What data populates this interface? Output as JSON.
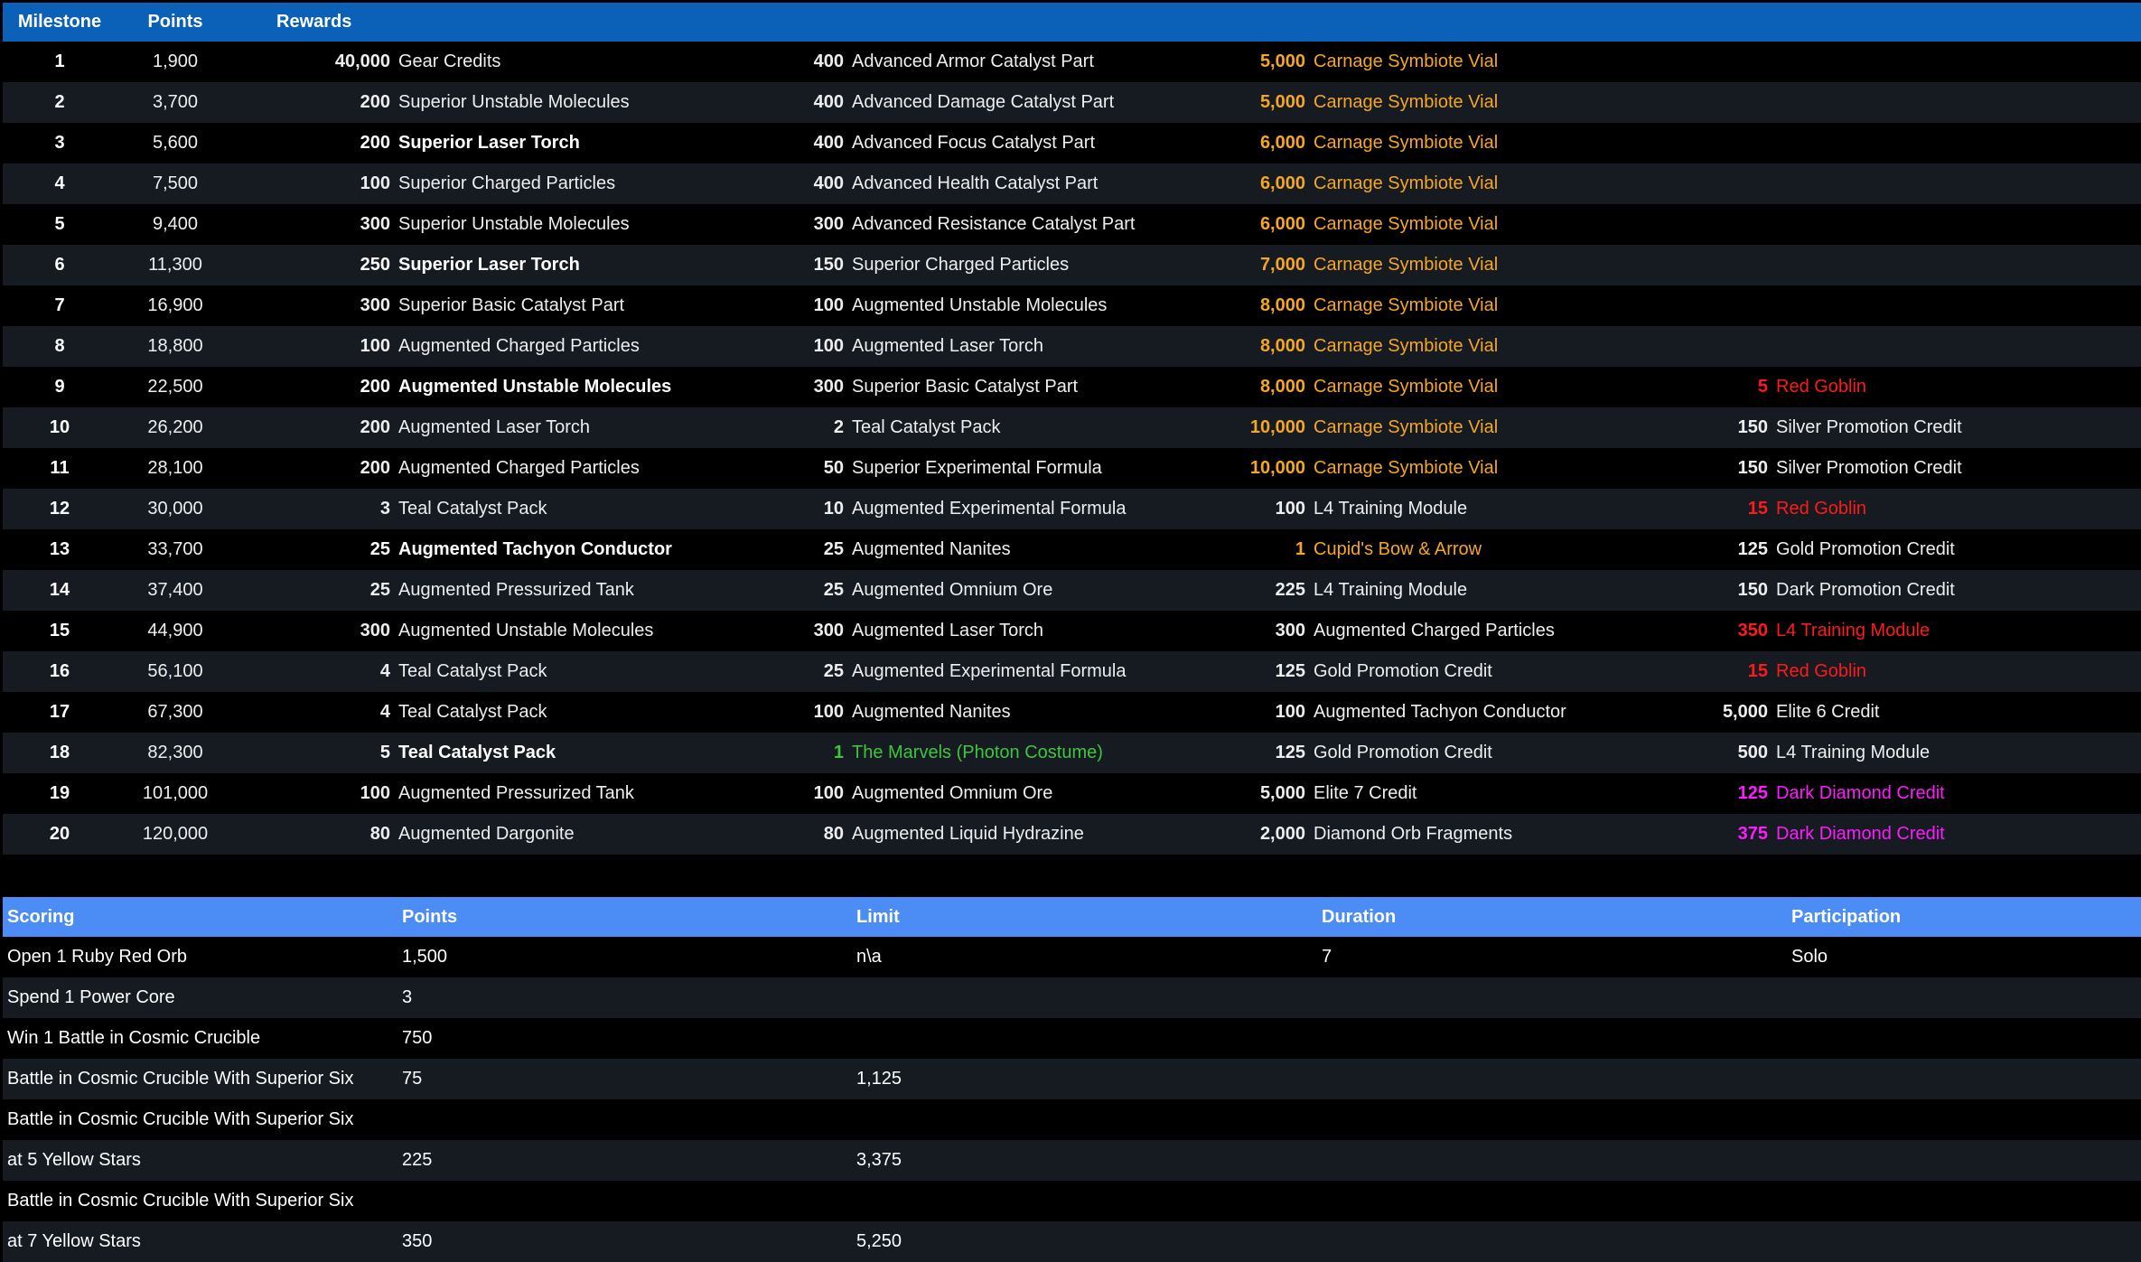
{
  "milestones_table": {
    "headers": {
      "milestone": "Milestone",
      "points": "Points",
      "rewards": "Rewards"
    },
    "colors": {
      "header_bg": "#0b61b8",
      "orange": "#f5a623",
      "red": "#ff1a1a",
      "green": "#3ec53e",
      "magenta": "#ff1aff"
    },
    "rows": [
      {
        "milestone": "1",
        "points": "1,900",
        "r1": {
          "q": "40,000",
          "n": "Gear Credits",
          "c": "white"
        },
        "r2": {
          "q": "400",
          "n": "Advanced Armor Catalyst Part",
          "c": "white"
        },
        "r3": {
          "q": "5,000",
          "n": "Carnage Symbiote Vial",
          "c": "orange"
        },
        "r4": {
          "q": "",
          "n": "",
          "c": "white"
        }
      },
      {
        "milestone": "2",
        "points": "3,700",
        "r1": {
          "q": "200",
          "n": "Superior Unstable Molecules",
          "c": "white"
        },
        "r2": {
          "q": "400",
          "n": "Advanced Damage Catalyst Part",
          "c": "white"
        },
        "r3": {
          "q": "5,000",
          "n": "Carnage Symbiote Vial",
          "c": "orange"
        },
        "r4": {
          "q": "",
          "n": "",
          "c": "white"
        }
      },
      {
        "milestone": "3",
        "points": "5,600",
        "r1": {
          "q": "200",
          "n": "Superior Laser Torch",
          "c": "bold"
        },
        "r2": {
          "q": "400",
          "n": "Advanced Focus Catalyst Part",
          "c": "white"
        },
        "r3": {
          "q": "6,000",
          "n": "Carnage Symbiote Vial",
          "c": "orange"
        },
        "r4": {
          "q": "",
          "n": "",
          "c": "white"
        }
      },
      {
        "milestone": "4",
        "points": "7,500",
        "r1": {
          "q": "100",
          "n": "Superior Charged Particles",
          "c": "white"
        },
        "r2": {
          "q": "400",
          "n": "Advanced Health Catalyst Part",
          "c": "white"
        },
        "r3": {
          "q": "6,000",
          "n": "Carnage Symbiote Vial",
          "c": "orange"
        },
        "r4": {
          "q": "",
          "n": "",
          "c": "white"
        }
      },
      {
        "milestone": "5",
        "points": "9,400",
        "r1": {
          "q": "300",
          "n": "Superior Unstable Molecules",
          "c": "white"
        },
        "r2": {
          "q": "300",
          "n": "Advanced Resistance Catalyst Part",
          "c": "white"
        },
        "r3": {
          "q": "6,000",
          "n": "Carnage Symbiote Vial",
          "c": "orange"
        },
        "r4": {
          "q": "",
          "n": "",
          "c": "white"
        }
      },
      {
        "milestone": "6",
        "points": "11,300",
        "r1": {
          "q": "250",
          "n": "Superior Laser Torch",
          "c": "bold"
        },
        "r2": {
          "q": "150",
          "n": "Superior Charged Particles",
          "c": "white"
        },
        "r3": {
          "q": "7,000",
          "n": "Carnage Symbiote Vial",
          "c": "orange"
        },
        "r4": {
          "q": "",
          "n": "",
          "c": "white"
        }
      },
      {
        "milestone": "7",
        "points": "16,900",
        "r1": {
          "q": "300",
          "n": "Superior Basic Catalyst Part",
          "c": "white"
        },
        "r2": {
          "q": "100",
          "n": "Augmented Unstable Molecules",
          "c": "white"
        },
        "r3": {
          "q": "8,000",
          "n": "Carnage Symbiote Vial",
          "c": "orange"
        },
        "r4": {
          "q": "",
          "n": "",
          "c": "white"
        }
      },
      {
        "milestone": "8",
        "points": "18,800",
        "r1": {
          "q": "100",
          "n": "Augmented Charged Particles",
          "c": "white"
        },
        "r2": {
          "q": "100",
          "n": "Augmented Laser Torch",
          "c": "white"
        },
        "r3": {
          "q": "8,000",
          "n": "Carnage Symbiote Vial",
          "c": "orange"
        },
        "r4": {
          "q": "",
          "n": "",
          "c": "white"
        }
      },
      {
        "milestone": "9",
        "points": "22,500",
        "r1": {
          "q": "200",
          "n": "Augmented Unstable Molecules",
          "c": "bold"
        },
        "r2": {
          "q": "300",
          "n": "Superior Basic Catalyst Part",
          "c": "white"
        },
        "r3": {
          "q": "8,000",
          "n": "Carnage Symbiote Vial",
          "c": "orange"
        },
        "r4": {
          "q": "5",
          "n": "Red Goblin",
          "c": "red"
        }
      },
      {
        "milestone": "10",
        "points": "26,200",
        "r1": {
          "q": "200",
          "n": "Augmented Laser Torch",
          "c": "white"
        },
        "r2": {
          "q": "2",
          "n": "Teal Catalyst Pack",
          "c": "white"
        },
        "r3": {
          "q": "10,000",
          "n": "Carnage Symbiote Vial",
          "c": "orange"
        },
        "r4": {
          "q": "150",
          "n": "Silver Promotion Credit",
          "c": "white"
        }
      },
      {
        "milestone": "11",
        "points": "28,100",
        "r1": {
          "q": "200",
          "n": "Augmented Charged Particles",
          "c": "white"
        },
        "r2": {
          "q": "50",
          "n": "Superior Experimental Formula",
          "c": "white"
        },
        "r3": {
          "q": "10,000",
          "n": "Carnage Symbiote Vial",
          "c": "orange"
        },
        "r4": {
          "q": "150",
          "n": "Silver Promotion Credit",
          "c": "white"
        }
      },
      {
        "milestone": "12",
        "points": "30,000",
        "r1": {
          "q": "3",
          "n": "Teal Catalyst Pack",
          "c": "white"
        },
        "r2": {
          "q": "10",
          "n": "Augmented Experimental Formula",
          "c": "white"
        },
        "r3": {
          "q": "100",
          "n": "L4 Training Module",
          "c": "white"
        },
        "r4": {
          "q": "15",
          "n": "Red Goblin",
          "c": "red"
        }
      },
      {
        "milestone": "13",
        "points": "33,700",
        "r1": {
          "q": "25",
          "n": "Augmented Tachyon Conductor",
          "c": "bold"
        },
        "r2": {
          "q": "25",
          "n": "Augmented Nanites",
          "c": "white"
        },
        "r3": {
          "q": "1",
          "n": "Cupid's Bow & Arrow",
          "c": "orange"
        },
        "r4": {
          "q": "125",
          "n": "Gold Promotion Credit",
          "c": "white"
        }
      },
      {
        "milestone": "14",
        "points": "37,400",
        "r1": {
          "q": "25",
          "n": "Augmented Pressurized Tank",
          "c": "white"
        },
        "r2": {
          "q": "25",
          "n": "Augmented Omnium Ore",
          "c": "white"
        },
        "r3": {
          "q": "225",
          "n": "L4 Training Module",
          "c": "white"
        },
        "r4": {
          "q": "150",
          "n": "Dark Promotion Credit",
          "c": "white"
        }
      },
      {
        "milestone": "15",
        "points": "44,900",
        "r1": {
          "q": "300",
          "n": "Augmented Unstable Molecules",
          "c": "white"
        },
        "r2": {
          "q": "300",
          "n": "Augmented Laser Torch",
          "c": "white"
        },
        "r3": {
          "q": "300",
          "n": "Augmented Charged Particles",
          "c": "white"
        },
        "r4": {
          "q": "350",
          "n": "L4 Training Module",
          "c": "red"
        }
      },
      {
        "milestone": "16",
        "points": "56,100",
        "r1": {
          "q": "4",
          "n": "Teal Catalyst Pack",
          "c": "white"
        },
        "r2": {
          "q": "25",
          "n": "Augmented Experimental Formula",
          "c": "white"
        },
        "r3": {
          "q": "125",
          "n": "Gold Promotion Credit",
          "c": "white"
        },
        "r4": {
          "q": "15",
          "n": "Red Goblin",
          "c": "red"
        }
      },
      {
        "milestone": "17",
        "points": "67,300",
        "r1": {
          "q": "4",
          "n": "Teal Catalyst Pack",
          "c": "white"
        },
        "r2": {
          "q": "100",
          "n": "Augmented Nanites",
          "c": "white"
        },
        "r3": {
          "q": "100",
          "n": "Augmented Tachyon Conductor",
          "c": "white"
        },
        "r4": {
          "q": "5,000",
          "n": "Elite 6 Credit",
          "c": "white"
        }
      },
      {
        "milestone": "18",
        "points": "82,300",
        "r1": {
          "q": "5",
          "n": "Teal Catalyst Pack",
          "c": "bold"
        },
        "r2": {
          "q": "1",
          "n": "The Marvels (Photon Costume)",
          "c": "green"
        },
        "r3": {
          "q": "125",
          "n": "Gold Promotion Credit",
          "c": "white"
        },
        "r4": {
          "q": "500",
          "n": "L4 Training Module",
          "c": "white"
        }
      },
      {
        "milestone": "19",
        "points": "101,000",
        "r1": {
          "q": "100",
          "n": "Augmented Pressurized Tank",
          "c": "white"
        },
        "r2": {
          "q": "100",
          "n": "Augmented Omnium Ore",
          "c": "white"
        },
        "r3": {
          "q": "5,000",
          "n": "Elite 7 Credit",
          "c": "white"
        },
        "r4": {
          "q": "125",
          "n": "Dark Diamond Credit",
          "c": "magenta"
        }
      },
      {
        "milestone": "20",
        "points": "120,000",
        "r1": {
          "q": "80",
          "n": "Augmented Dargonite",
          "c": "white"
        },
        "r2": {
          "q": "80",
          "n": "Augmented Liquid Hydrazine",
          "c": "white"
        },
        "r3": {
          "q": "2,000",
          "n": "Diamond Orb Fragments",
          "c": "white"
        },
        "r4": {
          "q": "375",
          "n": "Dark Diamond Credit",
          "c": "magenta"
        }
      }
    ]
  },
  "scoring_table": {
    "headers": {
      "scoring": "Scoring",
      "points": "Points",
      "limit": "Limit",
      "duration": "Duration",
      "participation": "Participation"
    },
    "colors": {
      "header_bg": "#4c8df5"
    },
    "rows": [
      {
        "scoring": "Open 1 Ruby Red Orb",
        "points": "1,500",
        "limit": "n\\a",
        "duration": "7",
        "participation": "Solo"
      },
      {
        "scoring": "Spend 1 Power Core",
        "points": "3",
        "limit": "",
        "duration": "",
        "participation": ""
      },
      {
        "scoring": "Win 1 Battle in Cosmic Crucible",
        "points": "750",
        "limit": "",
        "duration": "",
        "participation": ""
      },
      {
        "scoring": "Battle in Cosmic Crucible With Superior Six",
        "points": "75",
        "limit": "1,125",
        "duration": "",
        "participation": ""
      },
      {
        "scoring": "Battle in Cosmic Crucible With Superior Six",
        "points": "",
        "limit": "",
        "duration": "",
        "participation": ""
      },
      {
        "scoring": "at 5 Yellow Stars",
        "points": "225",
        "limit": "3,375",
        "duration": "",
        "participation": ""
      },
      {
        "scoring": "Battle in Cosmic Crucible With Superior Six",
        "points": "",
        "limit": "",
        "duration": "",
        "participation": ""
      },
      {
        "scoring": "at 7 Yellow Stars",
        "points": "350",
        "limit": "5,250",
        "duration": "",
        "participation": ""
      }
    ]
  }
}
